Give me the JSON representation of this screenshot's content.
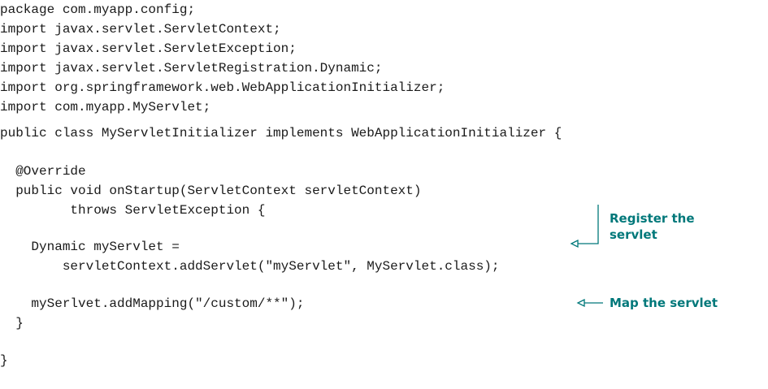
{
  "code": {
    "lines": [
      "package com.myapp.config;",
      "import javax.servlet.ServletContext;",
      "import javax.servlet.ServletException;",
      "import javax.servlet.ServletRegistration.Dynamic;",
      "import org.springframework.web.WebApplicationInitializer;",
      "import com.myapp.MyServlet;",
      "public class MyServletInitializer implements WebApplicationInitializer {",
      "  @Override",
      "  public void onStartup(ServletContext servletContext)",
      "         throws ServletException {",
      "    Dynamic myServlet =",
      "        servletContext.addServlet(\"myServlet\", MyServlet.class);",
      "    mySerlvet.addMapping(\"/custom/**\");",
      "  }",
      "}"
    ]
  },
  "annotations": {
    "register_line1": "Register the",
    "register_line2": "servlet",
    "map": "Map the servlet"
  },
  "colors": {
    "annotation": "#00787a",
    "code": "#1a1a1a"
  }
}
